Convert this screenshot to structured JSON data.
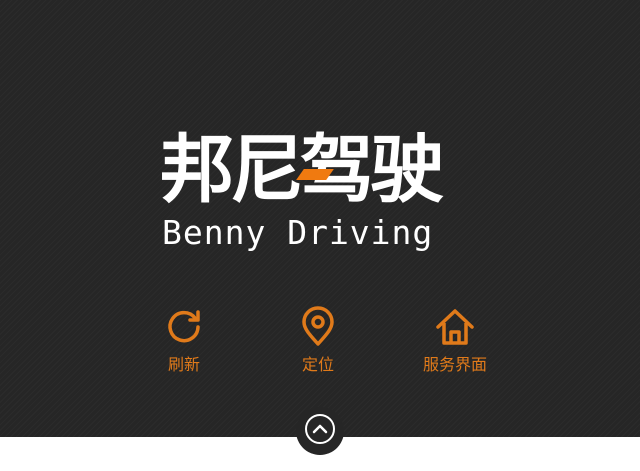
{
  "logo": {
    "name_cn": "邦尼驾驶",
    "name_en": "Benny Driving",
    "accent_color": "#f07a10"
  },
  "actions": [
    {
      "label": "刷新",
      "icon": "refresh-icon"
    },
    {
      "label": "定位",
      "icon": "location-pin-icon"
    },
    {
      "label": "服务界面",
      "icon": "home-icon"
    }
  ],
  "colors": {
    "background": "#262626",
    "accent": "#e07a1a",
    "bottom_bar": "#ffffff"
  },
  "collapse_toggle": {
    "icon": "chevron-up-icon"
  }
}
